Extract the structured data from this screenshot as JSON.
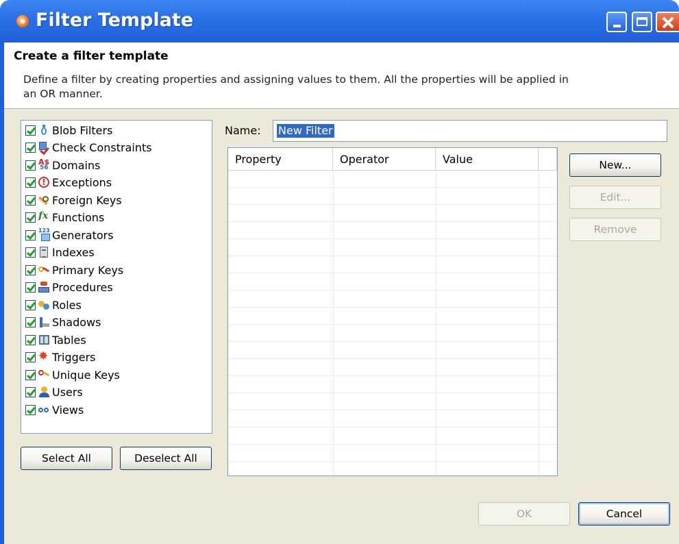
{
  "window": {
    "title": "Filter Template",
    "controls": {
      "minimize": "minimize",
      "maximize": "maximize",
      "close": "close"
    }
  },
  "banner": {
    "title": "Create a filter template",
    "description": "Define a filter by creating properties and assigning values to them. All the properties will be applied in an OR manner."
  },
  "object_types": [
    {
      "label": "Blob Filters",
      "icon": "blob-filter-icon",
      "checked": true
    },
    {
      "label": "Check Constraints",
      "icon": "check-constraint-icon",
      "checked": true
    },
    {
      "label": "Domains",
      "icon": "domain-icon",
      "checked": true
    },
    {
      "label": "Exceptions",
      "icon": "exception-icon",
      "checked": true
    },
    {
      "label": "Foreign Keys",
      "icon": "foreign-key-icon",
      "checked": true
    },
    {
      "label": "Functions",
      "icon": "function-icon",
      "checked": true
    },
    {
      "label": "Generators",
      "icon": "generator-icon",
      "checked": true
    },
    {
      "label": "Indexes",
      "icon": "index-icon",
      "checked": true
    },
    {
      "label": "Primary Keys",
      "icon": "primary-key-icon",
      "checked": true
    },
    {
      "label": "Procedures",
      "icon": "procedure-icon",
      "checked": true
    },
    {
      "label": "Roles",
      "icon": "roles-icon",
      "checked": true
    },
    {
      "label": "Shadows",
      "icon": "shadow-icon",
      "checked": true
    },
    {
      "label": "Tables",
      "icon": "table-icon",
      "checked": true
    },
    {
      "label": "Triggers",
      "icon": "trigger-icon",
      "checked": true
    },
    {
      "label": "Unique Keys",
      "icon": "unique-key-icon",
      "checked": true
    },
    {
      "label": "Users",
      "icon": "user-icon",
      "checked": true
    },
    {
      "label": "Views",
      "icon": "views-icon",
      "checked": true
    }
  ],
  "selection": {
    "select_all": "Select All",
    "deselect_all": "Deselect All"
  },
  "name_field": {
    "label": "Name:",
    "value": "New Filter"
  },
  "properties_table": {
    "columns": [
      "Property",
      "Operator",
      "Value"
    ],
    "rows": []
  },
  "property_actions": {
    "new": "New...",
    "edit": "Edit...",
    "remove": "Remove"
  },
  "footer": {
    "ok": "OK",
    "cancel": "Cancel"
  },
  "colors": {
    "titlebar": "#2a6fe6",
    "dialog_bg": "#ece9d8",
    "selection": "#316ac5",
    "checkmark": "#21a121"
  }
}
